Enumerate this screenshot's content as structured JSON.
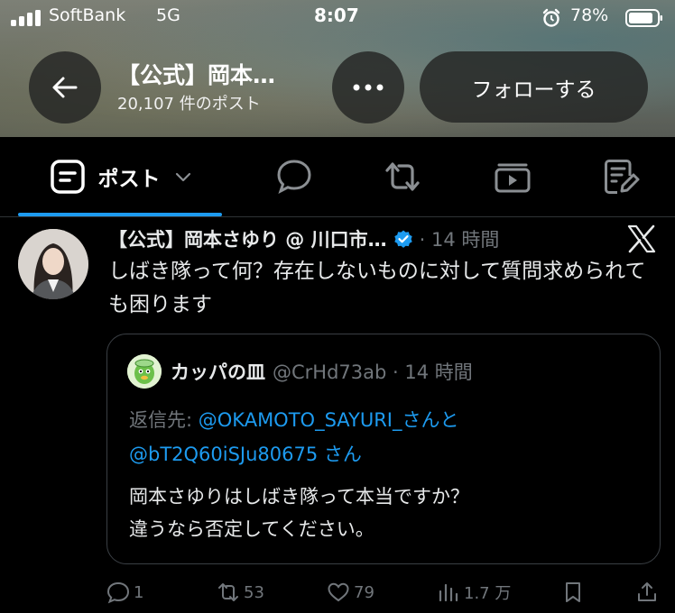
{
  "status": {
    "carrier": "SoftBank",
    "network": "5G",
    "time": "8:07",
    "battery_percent": "78%"
  },
  "header": {
    "title": "【公式】岡本…",
    "post_count": "20,107 件のポスト",
    "follow_label": "フォローする"
  },
  "tabs": {
    "posts_label": "ポスト"
  },
  "tweet": {
    "name": "【公式】岡本さゆり @ 川口市…",
    "time": "· 14 時間",
    "text": "しばき隊って何？存在しないものに対して質問求められても困ります",
    "quote": {
      "name": "カッパの皿",
      "handle": "@CrHd73ab · 14 時間",
      "reply_prefix": "返信先: ",
      "mention1": "@OKAMOTO_SAYURI_",
      "reply_and": "さんと",
      "mention2": "@bT2Q60iSJu80675",
      "reply_suffix": " さん",
      "text": "岡本さゆりはしばき隊って本当ですか？\n違うなら否定してください。"
    },
    "actions": {
      "replies": "1",
      "reposts": "53",
      "likes": "79",
      "views": "1.7 万"
    }
  },
  "colors": {
    "accent": "#1d9bf0",
    "muted": "#71767b",
    "text": "#e7e9ea"
  }
}
